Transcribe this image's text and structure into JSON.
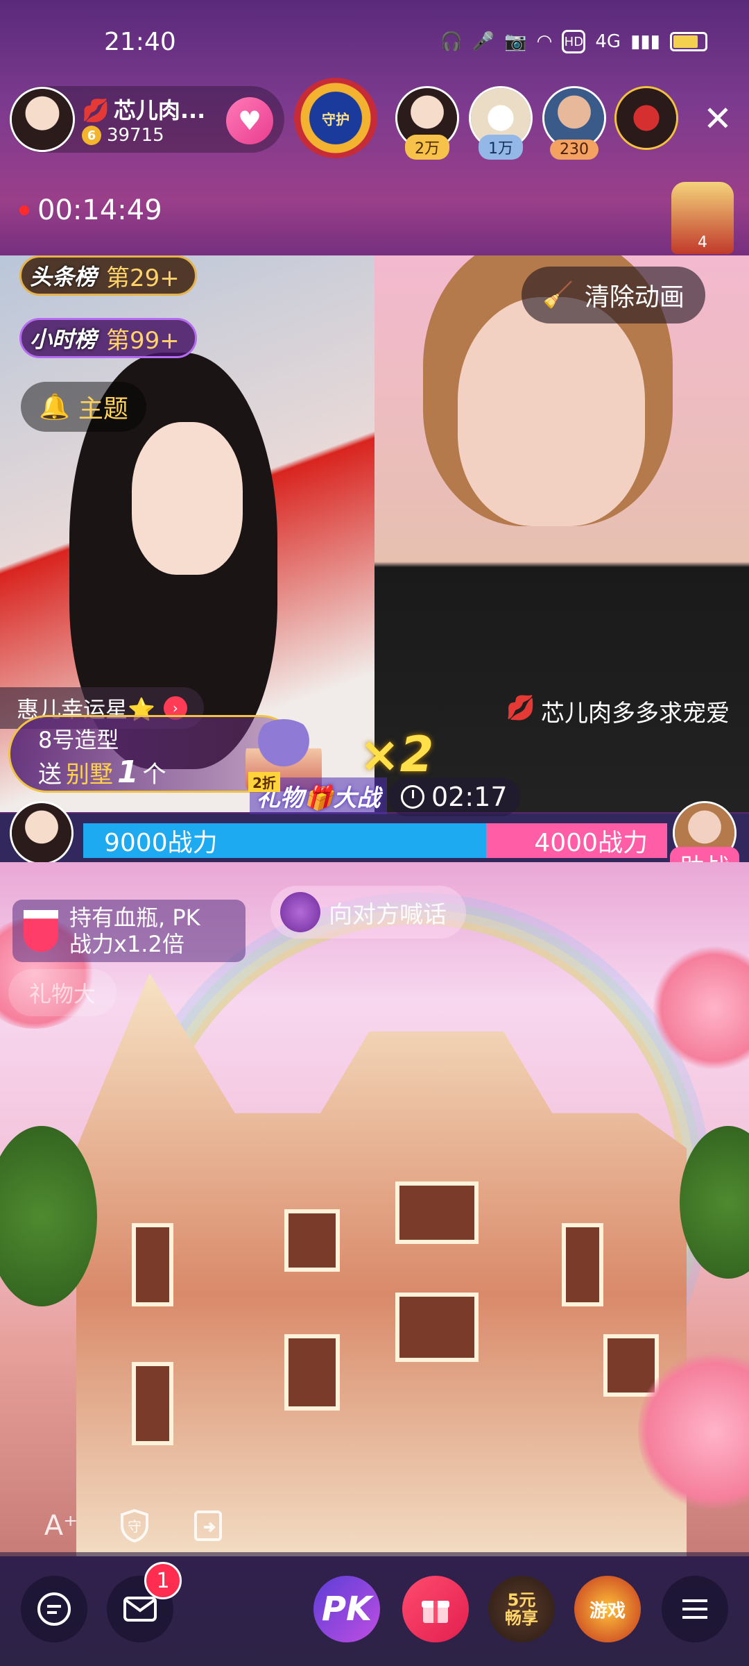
{
  "status_bar": {
    "time": "21:40",
    "network": "4G",
    "hd": "HD"
  },
  "host": {
    "name": "芯儿肉...",
    "level": "6",
    "fans": "39715"
  },
  "guard_badge": {
    "text": "守护"
  },
  "viewers": [
    {
      "count": "2万"
    },
    {
      "count": "1万"
    },
    {
      "count": "230"
    }
  ],
  "recording": {
    "time": "00:14:49"
  },
  "throne": {
    "count": "4"
  },
  "ranks": [
    {
      "tag": "头条榜",
      "value": "第29+"
    },
    {
      "tag": "小时榜",
      "value": "第99+"
    }
  ],
  "topic_label": "主题",
  "clear_animation_label": "清除动画",
  "lucky_tag": "惠儿幸运星⭐",
  "gift_message": {
    "line1": "8号造型",
    "send": "送",
    "gift": "别墅",
    "count": "1",
    "unit": "个"
  },
  "multiplier": "×2",
  "streamer_label": "芯儿肉多多求宠爱",
  "pk": {
    "discount": "2折",
    "title": "礼物🎁大战",
    "timer": "02:17",
    "left_power": "9000战力",
    "right_power": "4000战力",
    "help_label": "助战",
    "left_ratio": 0.69
  },
  "notice": {
    "line1": "持有血瓶, PK",
    "line2": "战力x1.2倍"
  },
  "shout_label": "向对方喊话",
  "faded_tag": "礼物大",
  "messages_badge": "1",
  "deal_label": {
    "line1": "5元",
    "line2": "畅享"
  },
  "game_label": "游戏",
  "pk_button_label": "PK",
  "colors": {
    "accent_pink": "#ff5ea6",
    "accent_blue": "#1daaf1",
    "gold": "#ffd36a"
  }
}
